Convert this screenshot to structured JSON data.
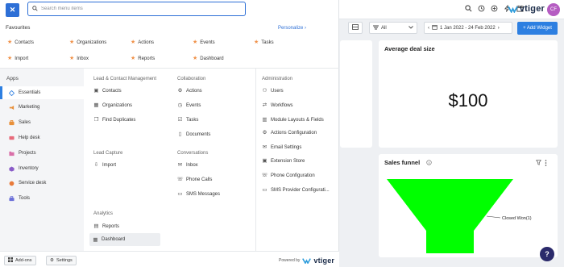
{
  "search": {
    "placeholder": "Search menu items"
  },
  "favourites": {
    "title": "Favourites",
    "personalize": "Personalize ›",
    "items": [
      "Contacts",
      "Organizations",
      "Actions",
      "Events",
      "Tasks",
      "Import",
      "Inbox",
      "Reports",
      "Dashboard"
    ]
  },
  "apps": {
    "title": "Apps",
    "items": [
      {
        "label": "Essentials",
        "icon": "diamond-icon"
      },
      {
        "label": "Marketing",
        "icon": "megaphone-icon"
      },
      {
        "label": "Sales",
        "icon": "sales-icon"
      },
      {
        "label": "Help desk",
        "icon": "help-desk-icon"
      },
      {
        "label": "Projects",
        "icon": "projects-icon"
      },
      {
        "label": "Inventory",
        "icon": "inventory-icon"
      },
      {
        "label": "Service desk",
        "icon": "service-desk-icon"
      },
      {
        "label": "Tools",
        "icon": "tools-icon"
      }
    ]
  },
  "groups": {
    "lead_contact": {
      "title": "Lead & Contact Management",
      "items": [
        "Contacts",
        "Organizations",
        "Find Duplicates"
      ]
    },
    "lead_capture": {
      "title": "Lead Capture",
      "items": [
        "Import"
      ]
    },
    "analytics": {
      "title": "Analytics",
      "items": [
        "Reports",
        "Dashboard"
      ]
    },
    "collaboration": {
      "title": "Collaboration",
      "items": [
        "Actions",
        "Events",
        "Tasks",
        "Documents"
      ]
    },
    "conversations": {
      "title": "Conversations",
      "items": [
        "Inbox",
        "Phone Calls",
        "SMS Messages"
      ]
    },
    "administration": {
      "title": "Administration",
      "items": [
        "Users",
        "Workflows",
        "Module Layouts & Fields",
        "Actions Configuration",
        "Email Settings",
        "Extension Store",
        "Phone Configuration",
        "SMS Provider Configurati..."
      ]
    }
  },
  "bottom": {
    "addons": "Add-ons",
    "settings": "Settings",
    "powered_by": "Powered by",
    "brand": "vtiger"
  },
  "header": {
    "brand": "vtiger",
    "avatar": "CF"
  },
  "dashboard": {
    "filter_value": "All",
    "date_range": "1 Jan 2022 - 24 Feb 2022",
    "add_widget": "+ Add Widget",
    "deal_card_title": "Average deal size",
    "deal_value": "$100",
    "funnel_title": "Sales funnel",
    "funnel_label": "Closed Won(1)"
  },
  "colors": {
    "accent": "#2d6fd6",
    "star": "#f0924a",
    "funnel": "#00ff00",
    "avatar": "#b55cc2"
  }
}
